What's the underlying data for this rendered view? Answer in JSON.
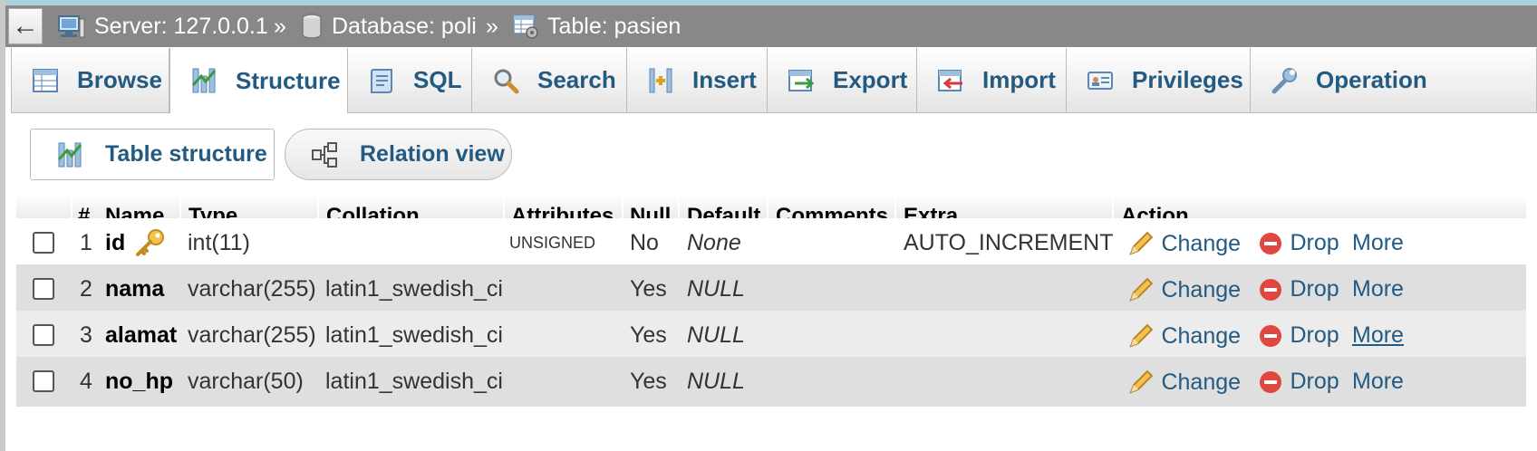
{
  "breadcrumb": {
    "back_label": "←",
    "separator": "»",
    "server": "Server: 127.0.0.1",
    "database": "Database: poli",
    "table": "Table: pasien"
  },
  "tabs": [
    {
      "label": "Browse",
      "icon": "browse-icon"
    },
    {
      "label": "Structure",
      "icon": "structure-icon",
      "active": true
    },
    {
      "label": "SQL",
      "icon": "sql-icon"
    },
    {
      "label": "Search",
      "icon": "search-icon"
    },
    {
      "label": "Insert",
      "icon": "insert-icon"
    },
    {
      "label": "Export",
      "icon": "export-icon"
    },
    {
      "label": "Import",
      "icon": "import-icon"
    },
    {
      "label": "Privileges",
      "icon": "privileges-icon"
    },
    {
      "label": "Operation",
      "icon": "wrench-icon"
    }
  ],
  "subnav": {
    "table_structure": "Table structure",
    "relation_view": "Relation view"
  },
  "table": {
    "headers": [
      "#",
      "Name",
      "Type",
      "Collation",
      "Attributes",
      "Null",
      "Default",
      "Comments",
      "Extra",
      "Action"
    ],
    "rows": [
      {
        "num": "1",
        "name": "id",
        "type": "int(11)",
        "collation": "",
        "attributes": "UNSIGNED",
        "null": "No",
        "default": "None",
        "comments": "",
        "extra": "AUTO_INCREMENT",
        "primary_key": true
      },
      {
        "num": "2",
        "name": "nama",
        "type": "varchar(255)",
        "collation": "latin1_swedish_ci",
        "attributes": "",
        "null": "Yes",
        "default": "NULL",
        "comments": "",
        "extra": ""
      },
      {
        "num": "3",
        "name": "alamat",
        "type": "varchar(255)",
        "collation": "latin1_swedish_ci",
        "attributes": "",
        "null": "Yes",
        "default": "NULL",
        "comments": "",
        "extra": ""
      },
      {
        "num": "4",
        "name": "no_hp",
        "type": "varchar(50)",
        "collation": "latin1_swedish_ci",
        "attributes": "",
        "null": "Yes",
        "default": "NULL",
        "comments": "",
        "extra": ""
      }
    ],
    "actions": {
      "change": "Change",
      "drop": "Drop",
      "more": "More"
    }
  },
  "colors": {
    "link": "#235a81",
    "breadcrumb_bar": "#888888",
    "row_alt": "#dfdfdf",
    "row_light": "#ececec",
    "drop_icon": "#e0473f",
    "key_icon": "#e8a52a"
  }
}
